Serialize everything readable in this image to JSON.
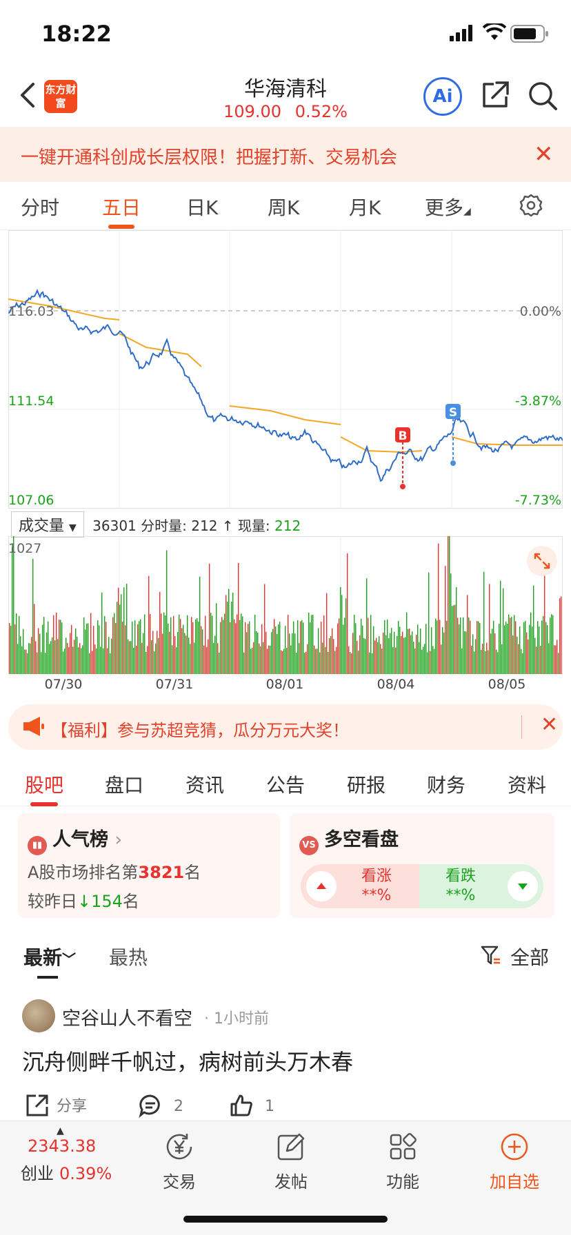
{
  "status": {
    "time": "18:22"
  },
  "header": {
    "logo_text": "东方财富",
    "title": "华海清科",
    "price": "109.00",
    "change": "0.52%",
    "ai_label": "Ai"
  },
  "promo": {
    "text": "一键开通科创成长层权限！把握打新、交易机会"
  },
  "chart_tabs": [
    {
      "label": "分时"
    },
    {
      "label": "五日"
    },
    {
      "label": "日K"
    },
    {
      "label": "周K"
    },
    {
      "label": "月K"
    },
    {
      "label": "更多"
    }
  ],
  "chart_labels": {
    "price_top": "116.03",
    "price_mid": "111.54",
    "price_low": "107.06",
    "pct_top": "0.00%",
    "pct_mid": "-3.87%",
    "pct_low": "-7.73%",
    "buy_marker": "B",
    "sell_marker": "S",
    "vol_max": "1027"
  },
  "volume_bar": {
    "selector": "成交量",
    "total": "36301",
    "fenshi_label": "分时量:",
    "fenshi_value": "212 ↑",
    "now_label": "现量:",
    "now_value": "212"
  },
  "dates": [
    "07/30",
    "07/31",
    "08/01",
    "08/04",
    "08/05"
  ],
  "chart_data": {
    "type": "line",
    "x": [
      "07/30",
      "07/31",
      "08/01",
      "08/04",
      "08/05"
    ],
    "series": [],
    "y_ticks": [
      "116.03",
      "111.54",
      "107.06"
    ],
    "pct_ticks": [
      "0.00%",
      "-3.87%",
      "-7.73%"
    ],
    "ylim": [
      107.06,
      116.03
    ],
    "volume_ylim": [
      0,
      1027
    ],
    "colors": {
      "price": "#2e6cc8",
      "avg": "#f5a623",
      "up": "#e8322b",
      "down": "#1aa31a"
    }
  },
  "promo2": {
    "text": "【福利】参与苏超竞猜，瓜分万元大奖！"
  },
  "section_tabs": [
    "股吧",
    "盘口",
    "资讯",
    "公告",
    "研报",
    "财务",
    "资料"
  ],
  "popularity": {
    "title": "人气榜",
    "rank_prefix": "A股市场排名第",
    "rank": "3821",
    "rank_suffix": "名",
    "change_prefix": "较昨日",
    "change": "154",
    "change_suffix": "名"
  },
  "sentiment": {
    "title": "多空看盘",
    "up_label": "看涨",
    "up_value": "**%",
    "down_label": "看跌",
    "down_value": "**%"
  },
  "sort": {
    "newest": "最新",
    "hot": "最热",
    "all": "全部"
  },
  "post": {
    "user": "空谷山人不看空",
    "time": "· 1小时前",
    "content": "沉舟侧畔千帆过，病树前头万木春",
    "share": "分享",
    "comments": "2",
    "likes": "1"
  },
  "bottom_nav": {
    "index_value": "2343.38",
    "index_name": "创业",
    "index_change": "0.39%",
    "items": [
      "交易",
      "发帖",
      "功能",
      "加自选"
    ]
  }
}
